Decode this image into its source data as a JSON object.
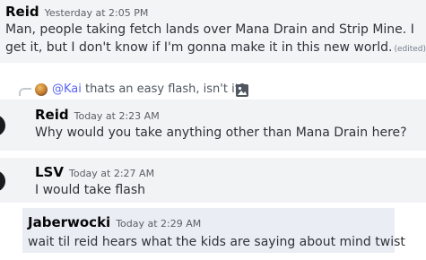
{
  "messages": [
    {
      "author": "Reid",
      "timestamp": "Yesterday at 2:05 PM",
      "lines": [
        "Man, people taking fetch lands over Mana Drain and Strip Mine. I",
        "get it, but I don't know if I'm gonna make it in this new world."
      ],
      "edited": "(edited)"
    },
    {
      "reply": {
        "mention": "@Kai",
        "text": "thats an easy flash, isn't it?"
      },
      "author": "Reid",
      "timestamp": "Today at 2:23 AM",
      "text": "Why would you take anything other than Mana Drain here?"
    },
    {
      "author": "LSV",
      "timestamp": "Today at 2:27 AM",
      "text": "I would take flash"
    },
    {
      "author": "Jaberwocki",
      "timestamp": "Today at 2:29 AM",
      "text": "wait til reid hears what the kids are saying about mind twist"
    }
  ],
  "colors": {
    "author": "#060607",
    "text": "#2e3338",
    "timestamp": "#5c5e66",
    "mention": "#5865f2",
    "hover_bg": "#f2f3f5",
    "highlight_bg": "#ebedf5"
  },
  "icons": [
    "reply-spine",
    "user-avatar",
    "image-icon"
  ]
}
